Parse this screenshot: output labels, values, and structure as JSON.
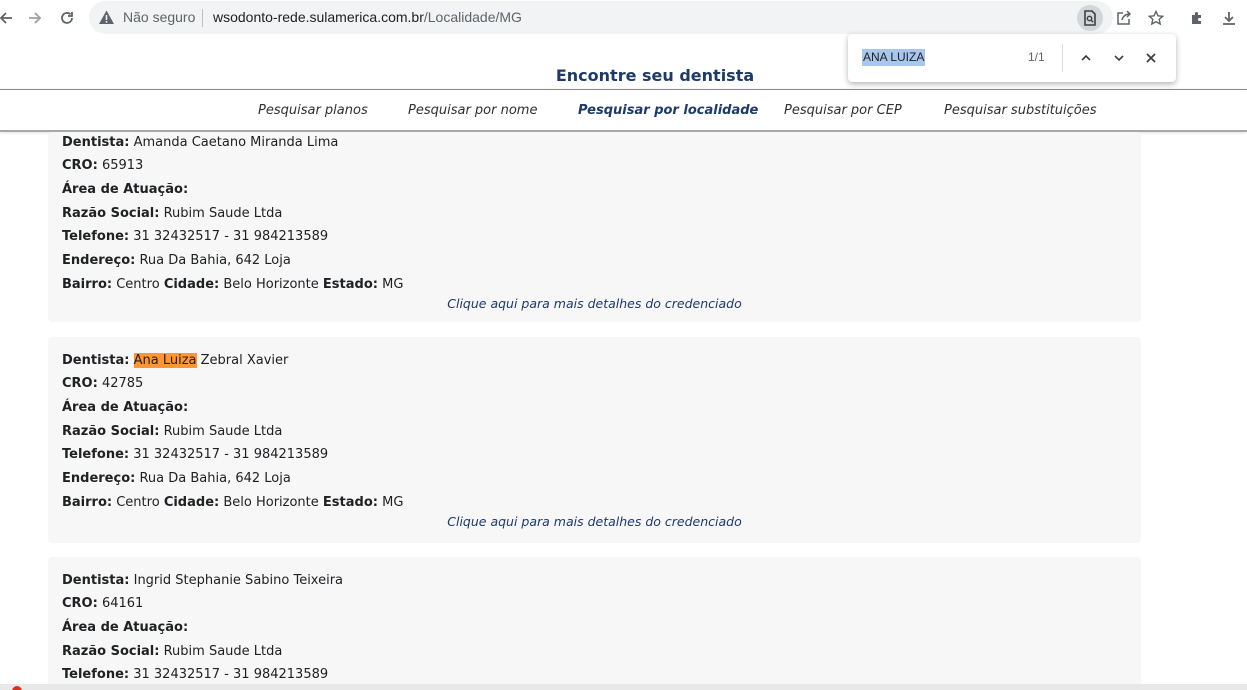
{
  "browser": {
    "security_label": "Não seguro",
    "url_host": "wsodonto-rede.sulamerica.com.br",
    "url_path": "/Localidade/MG",
    "icons": [
      "back-icon",
      "forward-icon",
      "reload-icon",
      "warning-icon",
      "find-in-page-icon",
      "share-icon",
      "star-icon",
      "extensions-icon",
      "download-icon"
    ]
  },
  "find": {
    "query": "ANA LUIZA",
    "count": "1/1"
  },
  "page": {
    "title": "Encontre seu dentista",
    "nav": [
      {
        "label": "Pesquisar planos"
      },
      {
        "label": "Pesquisar por nome"
      },
      {
        "label": "Pesquisar por localidade",
        "active": true
      },
      {
        "label": "Pesquisar por CEP"
      },
      {
        "label": "Pesquisar substituições"
      }
    ]
  },
  "labels": {
    "dentista": "Dentista:",
    "cro": "CRO:",
    "area": "Área de Atuação:",
    "razao": "Razão Social:",
    "telefone": "Telefone:",
    "endereco": "Endereço:",
    "bairro": "Bairro:",
    "cidade": "Cidade:",
    "estado": "Estado:",
    "details": "Clique aqui para mais detalhes do credenciado"
  },
  "cards": [
    {
      "dentista_pre": "",
      "dentista_hl": "",
      "dentista_post": "Amanda Caetano Miranda Lima",
      "cro": "65913",
      "area": "",
      "razao": "Rubim Saude Ltda",
      "telefone": "31 32432517 - 31 984213589",
      "endereco": "Rua Da Bahia, 642 Loja",
      "bairro": "Centro",
      "cidade": "Belo Horizonte",
      "estado": "MG"
    },
    {
      "dentista_pre": "",
      "dentista_hl": "Ana Luiza",
      "dentista_post": " Zebral Xavier",
      "cro": "42785",
      "area": "",
      "razao": "Rubim Saude Ltda",
      "telefone": "31 32432517 - 31 984213589",
      "endereco": "Rua Da Bahia, 642 Loja",
      "bairro": "Centro",
      "cidade": "Belo Horizonte",
      "estado": "MG"
    },
    {
      "dentista_pre": "",
      "dentista_hl": "",
      "dentista_post": "Ingrid Stephanie Sabino Teixeira",
      "cro": "64161",
      "area": "",
      "razao": "Rubim Saude Ltda",
      "telefone": "31 32432517 - 31 984213589"
    }
  ]
}
